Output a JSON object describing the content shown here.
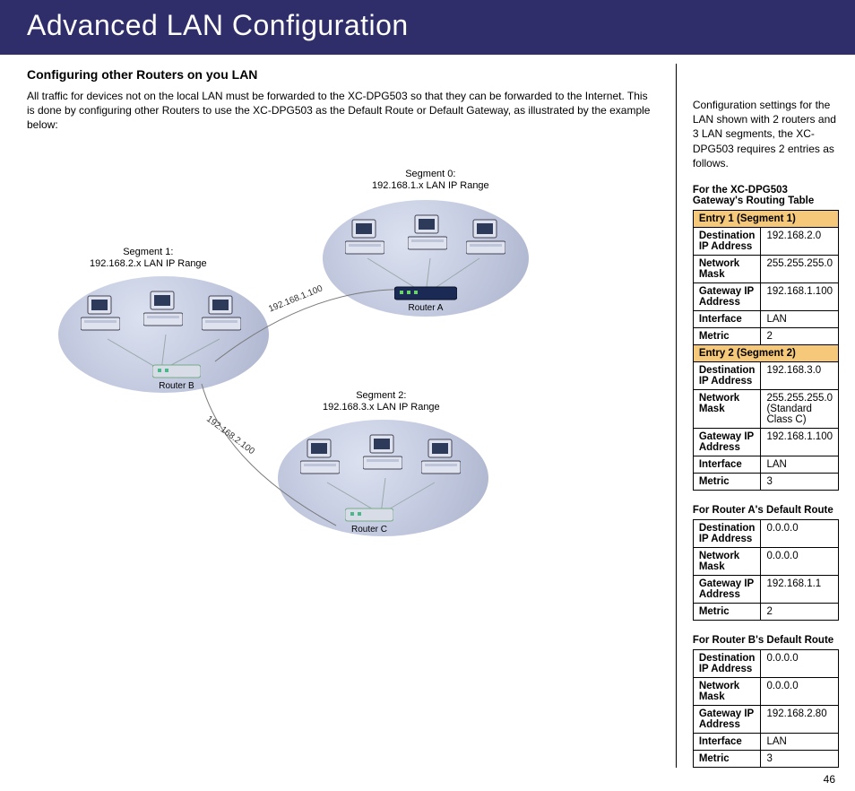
{
  "banner_title": "Advanced LAN Configuration",
  "section_title": "Configuring other Routers on you LAN",
  "intro_paragraph": "All traffic for devices not on the local LAN must be forwarded to the XC-DPG503 so that they can be forwarded to the Internet. This is done by configuring other Routers to use the XC-DPG503 as the Default Route or Default Gateway, as illustrated by the example below:",
  "diagram": {
    "segment0": "Segment 0:\n192.168.1.x LAN IP Range",
    "segment1": "Segment 1:\n192.168.2.x LAN IP Range",
    "segment2": "Segment 2:\n192.168.3.x LAN IP Range",
    "routerA": "Router A",
    "routerB": "Router B",
    "routerC": "Router C",
    "wire_a_b": "192.168.1.100",
    "wire_b_c": "192.168.2.100"
  },
  "right_intro": "Configuration settings for the LAN shown with 2 routers and 3 LAN segments, the XC-DPG503 requires 2 entries as follows.",
  "tables": {
    "gateway": {
      "caption": "For the XC-DPG503 Gateway's Routing Table",
      "entries": [
        {
          "title": "Entry 1 (Segment 1)",
          "rows": [
            {
              "label": "Destination IP Address",
              "value": "192.168.2.0"
            },
            {
              "label": "Network Mask",
              "value": "255.255.255.0"
            },
            {
              "label": "Gateway IP Address",
              "value": "192.168.1.100"
            },
            {
              "label": "Interface",
              "value": "LAN"
            },
            {
              "label": "Metric",
              "value": "2"
            }
          ]
        },
        {
          "title": "Entry 2 (Segment 2)",
          "rows": [
            {
              "label": "Destination IP Address",
              "value": "192.168.3.0"
            },
            {
              "label": "Network Mask",
              "value": "255.255.255.0 (Standard Class C)"
            },
            {
              "label": "Gateway IP Address",
              "value": "192.168.1.100"
            },
            {
              "label": "Interface",
              "value": "LAN"
            },
            {
              "label": "Metric",
              "value": "3"
            }
          ]
        }
      ]
    },
    "routerA": {
      "caption": "For Router A's Default Route",
      "rows": [
        {
          "label": "Destination IP Address",
          "value": "0.0.0.0"
        },
        {
          "label": "Network Mask",
          "value": "0.0.0.0"
        },
        {
          "label": "Gateway IP Address",
          "value": "192.168.1.1"
        },
        {
          "label": "Metric",
          "value": "2"
        }
      ]
    },
    "routerB": {
      "caption": "For Router B's Default Route",
      "rows": [
        {
          "label": "Destination IP Address",
          "value": "0.0.0.0"
        },
        {
          "label": "Network Mask",
          "value": "0.0.0.0"
        },
        {
          "label": "Gateway IP Address",
          "value": "192.168.2.80"
        },
        {
          "label": "Interface",
          "value": "LAN"
        },
        {
          "label": "Metric",
          "value": "3"
        }
      ]
    }
  },
  "page_number": "46"
}
